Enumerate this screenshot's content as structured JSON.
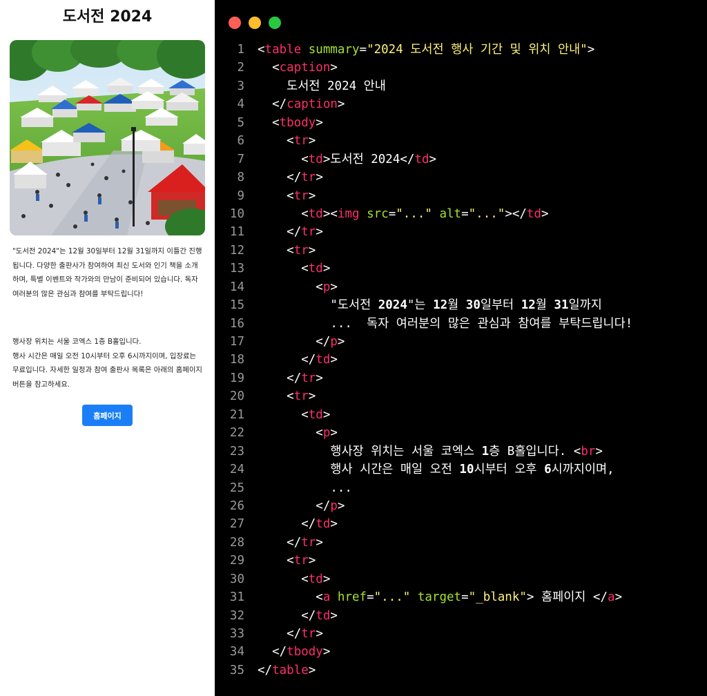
{
  "preview": {
    "title": "도서전 2024",
    "image_alt": "illustration of an outdoor book fair with colorful tents and crowds",
    "paragraph1": "\"도서전 2024\"는 12월 30일부터 12월 31일까지 이틀간 진행됩니다. 다양한 출판사가 참여하여 최신 도서와 인기 책을 소개하며, 특별 이벤트와 작가와의 만남이 준비되어 있습니다. 독자 여러분의 많은 관심과 참여를 부탁드립니다!",
    "paragraph2_line1": "행사장 위치는 서울 코엑스 1층 B홀입니다.",
    "paragraph2_line2": "행사 시간은 매일 오전 10시부터 오후 6시까지이며, 입장료는 무료입니다. 자세한 일정과 참여 출판사 목록은 아래의 홈페이지 버튼을 참고하세요.",
    "button_label": "홈페이지"
  },
  "editor": {
    "dot_colors": [
      "#ff5f57",
      "#febc2e",
      "#28c840"
    ],
    "colors": {
      "tag": "#ff2e6a",
      "attr": "#a6e22e",
      "string": "#fff27a",
      "text": "#ffffff",
      "line_number": "#9a9a9a"
    },
    "lines": [
      {
        "n": "1",
        "i": 0,
        "s": [
          [
            "p",
            "<"
          ],
          [
            "t",
            "table"
          ],
          [
            "a",
            " summary"
          ],
          [
            "p",
            "="
          ],
          [
            "s",
            "\"2024 도서전 행사 기간 및 위치 안내\""
          ],
          [
            "p",
            ">"
          ]
        ]
      },
      {
        "n": "2",
        "i": 1,
        "s": [
          [
            "p",
            "<"
          ],
          [
            "t",
            "caption"
          ],
          [
            "p",
            ">"
          ]
        ]
      },
      {
        "n": "3",
        "i": 2,
        "s": [
          [
            "p",
            "도서전 2024 안내"
          ]
        ]
      },
      {
        "n": "4",
        "i": 1,
        "s": [
          [
            "p",
            "</"
          ],
          [
            "t",
            "caption"
          ],
          [
            "p",
            ">"
          ]
        ]
      },
      {
        "n": "5",
        "i": 1,
        "s": [
          [
            "p",
            "<"
          ],
          [
            "t",
            "tbody"
          ],
          [
            "p",
            ">"
          ]
        ]
      },
      {
        "n": "6",
        "i": 2,
        "s": [
          [
            "p",
            "<"
          ],
          [
            "t",
            "tr"
          ],
          [
            "p",
            ">"
          ]
        ]
      },
      {
        "n": "7",
        "i": 3,
        "s": [
          [
            "p",
            "<"
          ],
          [
            "t",
            "td"
          ],
          [
            "p",
            ">도서전 2024</"
          ],
          [
            "t",
            "td"
          ],
          [
            "p",
            ">"
          ]
        ]
      },
      {
        "n": "8",
        "i": 2,
        "s": [
          [
            "p",
            "</"
          ],
          [
            "t",
            "tr"
          ],
          [
            "p",
            ">"
          ]
        ]
      },
      {
        "n": "9",
        "i": 2,
        "s": [
          [
            "p",
            "<"
          ],
          [
            "t",
            "tr"
          ],
          [
            "p",
            ">"
          ]
        ]
      },
      {
        "n": "10",
        "i": 3,
        "s": [
          [
            "p",
            "<"
          ],
          [
            "t",
            "td"
          ],
          [
            "p",
            "><"
          ],
          [
            "t",
            "img"
          ],
          [
            "a",
            " src"
          ],
          [
            "p",
            "="
          ],
          [
            "s",
            "\"...\""
          ],
          [
            "a",
            " alt"
          ],
          [
            "p",
            "="
          ],
          [
            "s",
            "\"...\""
          ],
          [
            "p",
            "></"
          ],
          [
            "t",
            "td"
          ],
          [
            "p",
            ">"
          ]
        ]
      },
      {
        "n": "11",
        "i": 2,
        "s": [
          [
            "p",
            "</"
          ],
          [
            "t",
            "tr"
          ],
          [
            "p",
            ">"
          ]
        ]
      },
      {
        "n": "12",
        "i": 2,
        "s": [
          [
            "p",
            "<"
          ],
          [
            "t",
            "tr"
          ],
          [
            "p",
            ">"
          ]
        ]
      },
      {
        "n": "13",
        "i": 3,
        "s": [
          [
            "p",
            "<"
          ],
          [
            "t",
            "td"
          ],
          [
            "p",
            ">"
          ]
        ]
      },
      {
        "n": "14",
        "i": 4,
        "s": [
          [
            "p",
            "<"
          ],
          [
            "t",
            "p"
          ],
          [
            "p",
            ">"
          ]
        ]
      },
      {
        "n": "15",
        "i": 5,
        "s": [
          [
            "p",
            "\"도서전 "
          ],
          [
            "b",
            "2024"
          ],
          [
            "p",
            "\"는 "
          ],
          [
            "b",
            "12"
          ],
          [
            "p",
            "월 "
          ],
          [
            "b",
            "30"
          ],
          [
            "p",
            "일부터 "
          ],
          [
            "b",
            "12"
          ],
          [
            "p",
            "월 "
          ],
          [
            "b",
            "31"
          ],
          [
            "p",
            "일까지"
          ]
        ]
      },
      {
        "n": "16",
        "i": 5,
        "s": [
          [
            "p",
            "...  독자 여러분의 많은 관심과 참여를 부탁드립니다!"
          ]
        ]
      },
      {
        "n": "17",
        "i": 4,
        "s": [
          [
            "p",
            "</"
          ],
          [
            "t",
            "p"
          ],
          [
            "p",
            ">"
          ]
        ]
      },
      {
        "n": "18",
        "i": 3,
        "s": [
          [
            "p",
            "</"
          ],
          [
            "t",
            "td"
          ],
          [
            "p",
            ">"
          ]
        ]
      },
      {
        "n": "19",
        "i": 2,
        "s": [
          [
            "p",
            "</"
          ],
          [
            "t",
            "tr"
          ],
          [
            "p",
            ">"
          ]
        ]
      },
      {
        "n": "20",
        "i": 2,
        "s": [
          [
            "p",
            "<"
          ],
          [
            "t",
            "tr"
          ],
          [
            "p",
            ">"
          ]
        ]
      },
      {
        "n": "21",
        "i": 3,
        "s": [
          [
            "p",
            "<"
          ],
          [
            "t",
            "td"
          ],
          [
            "p",
            ">"
          ]
        ]
      },
      {
        "n": "22",
        "i": 4,
        "s": [
          [
            "p",
            "<"
          ],
          [
            "t",
            "p"
          ],
          [
            "p",
            ">"
          ]
        ]
      },
      {
        "n": "23",
        "i": 5,
        "s": [
          [
            "p",
            "행사장 위치는 서울 코엑스 "
          ],
          [
            "b",
            "1"
          ],
          [
            "p",
            "층 B홀입니다. <"
          ],
          [
            "t",
            "br"
          ],
          [
            "p",
            ">"
          ]
        ]
      },
      {
        "n": "24",
        "i": 5,
        "s": [
          [
            "p",
            "행사 시간은 매일 오전 "
          ],
          [
            "b",
            "10"
          ],
          [
            "p",
            "시부터 오후 "
          ],
          [
            "b",
            "6"
          ],
          [
            "p",
            "시까지이며,"
          ]
        ]
      },
      {
        "n": "25",
        "i": 5,
        "s": [
          [
            "p",
            "..."
          ]
        ]
      },
      {
        "n": "26",
        "i": 4,
        "s": [
          [
            "p",
            "</"
          ],
          [
            "t",
            "p"
          ],
          [
            "p",
            ">"
          ]
        ]
      },
      {
        "n": "27",
        "i": 3,
        "s": [
          [
            "p",
            "</"
          ],
          [
            "t",
            "td"
          ],
          [
            "p",
            ">"
          ]
        ]
      },
      {
        "n": "28",
        "i": 2,
        "s": [
          [
            "p",
            "</"
          ],
          [
            "t",
            "tr"
          ],
          [
            "p",
            ">"
          ]
        ]
      },
      {
        "n": "29",
        "i": 2,
        "s": [
          [
            "p",
            "<"
          ],
          [
            "t",
            "tr"
          ],
          [
            "p",
            ">"
          ]
        ]
      },
      {
        "n": "30",
        "i": 3,
        "s": [
          [
            "p",
            "<"
          ],
          [
            "t",
            "td"
          ],
          [
            "p",
            ">"
          ]
        ]
      },
      {
        "n": "31",
        "i": 4,
        "s": [
          [
            "p",
            "<"
          ],
          [
            "t",
            "a"
          ],
          [
            "a",
            " href"
          ],
          [
            "p",
            "="
          ],
          [
            "s",
            "\"...\""
          ],
          [
            "a",
            " target"
          ],
          [
            "p",
            "="
          ],
          [
            "s",
            "\"_blank\""
          ],
          [
            "p",
            "> 홈페이지 </"
          ],
          [
            "t",
            "a"
          ],
          [
            "p",
            ">"
          ]
        ]
      },
      {
        "n": "32",
        "i": 3,
        "s": [
          [
            "p",
            "</"
          ],
          [
            "t",
            "td"
          ],
          [
            "p",
            ">"
          ]
        ]
      },
      {
        "n": "33",
        "i": 2,
        "s": [
          [
            "p",
            "</"
          ],
          [
            "t",
            "tr"
          ],
          [
            "p",
            ">"
          ]
        ]
      },
      {
        "n": "34",
        "i": 1,
        "s": [
          [
            "p",
            "</"
          ],
          [
            "t",
            "tbody"
          ],
          [
            "p",
            ">"
          ]
        ]
      },
      {
        "n": "35",
        "i": 0,
        "s": [
          [
            "p",
            "</"
          ],
          [
            "t",
            "table"
          ],
          [
            "p",
            ">"
          ]
        ]
      }
    ]
  }
}
